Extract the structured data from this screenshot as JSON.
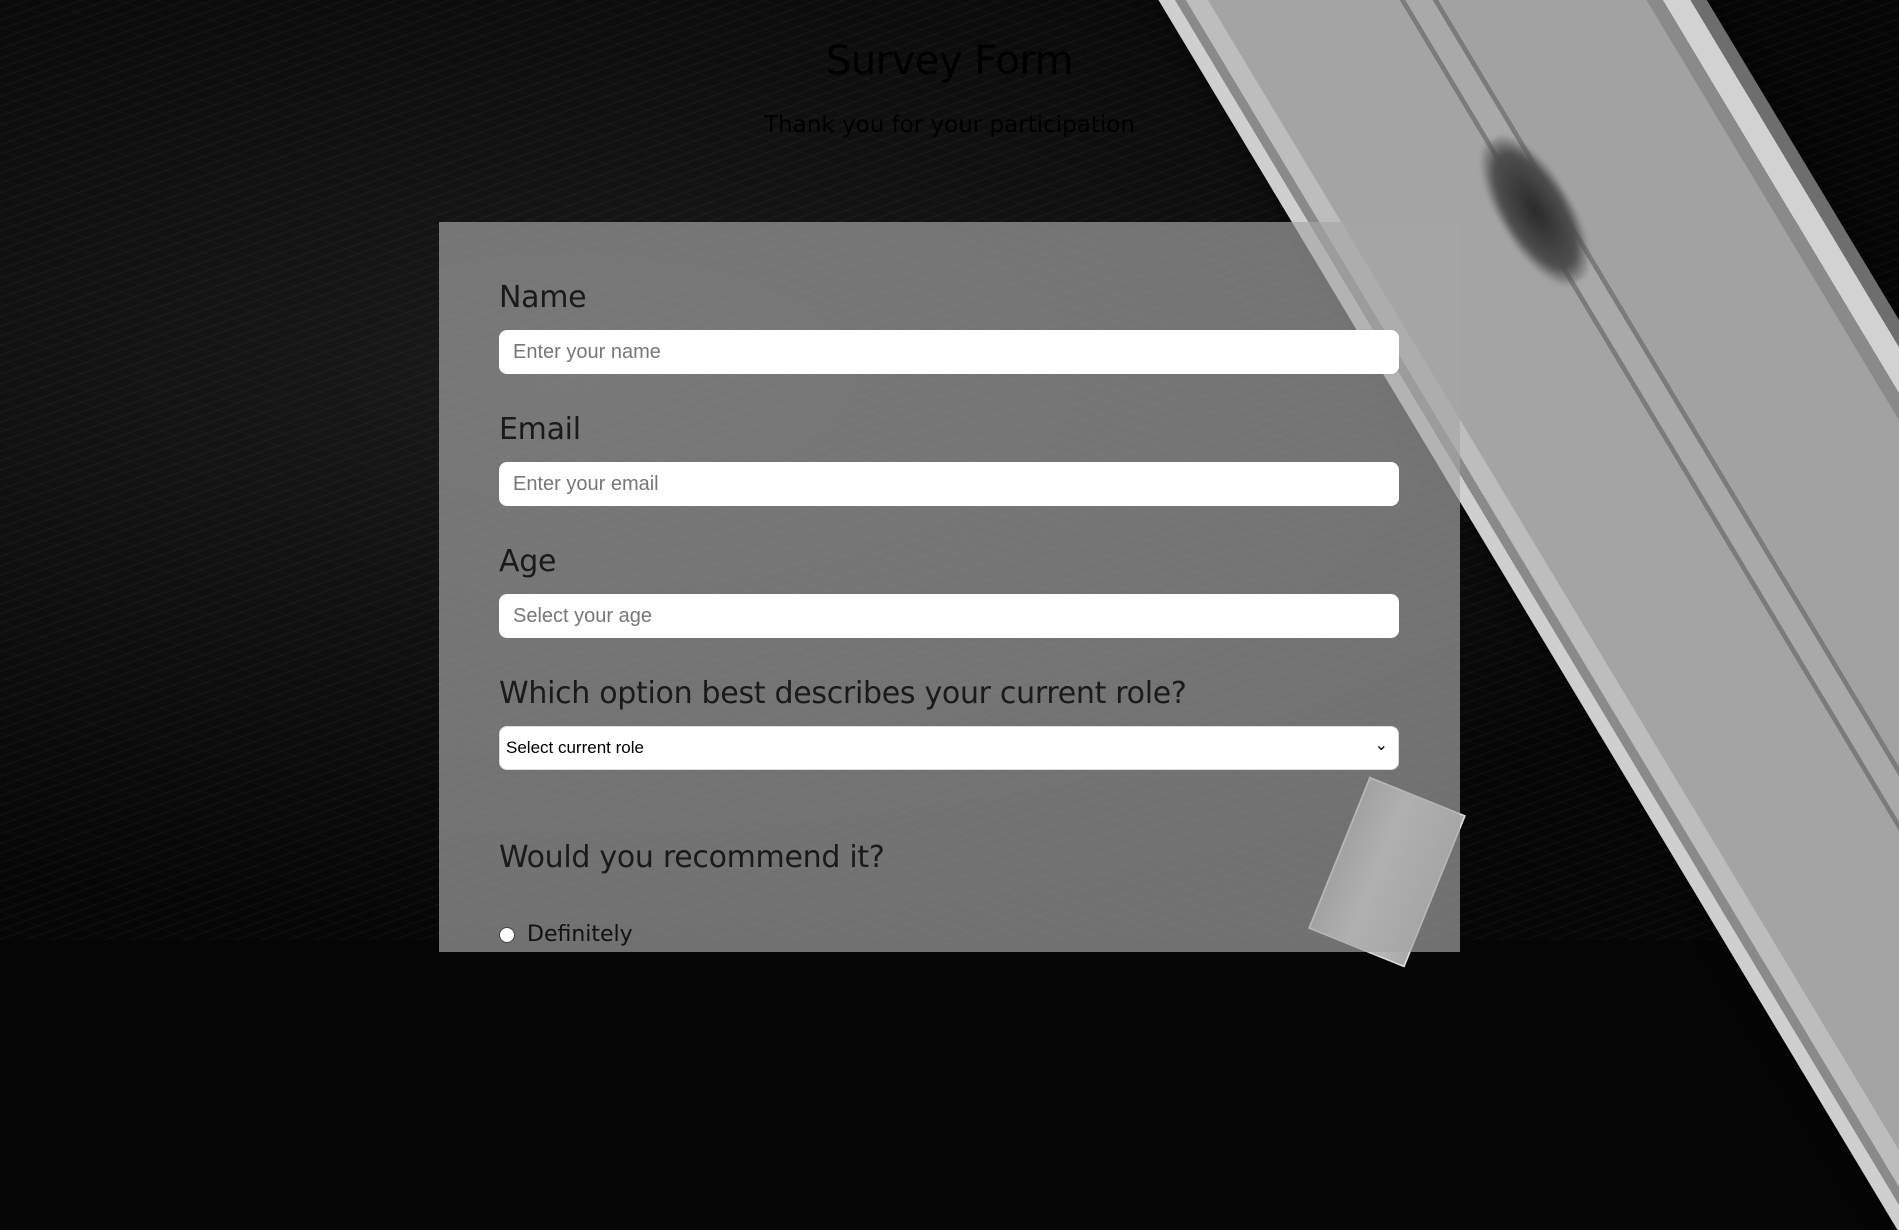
{
  "header": {
    "title": "Survey Form",
    "subtitle": "Thank you for your participation"
  },
  "form": {
    "name": {
      "label": "Name",
      "placeholder": "Enter your name"
    },
    "email": {
      "label": "Email",
      "placeholder": "Enter your email"
    },
    "age": {
      "label": "Age",
      "placeholder": "Select your age"
    },
    "role": {
      "label": "Which option best describes your current role?",
      "selected": "Select current role"
    },
    "recommend": {
      "label": "Would you recommend it?",
      "options": [
        "Definitely"
      ]
    }
  },
  "colors": {
    "panel": "#a5a5a5",
    "background": "#050505",
    "title_text": "#ffffff"
  }
}
